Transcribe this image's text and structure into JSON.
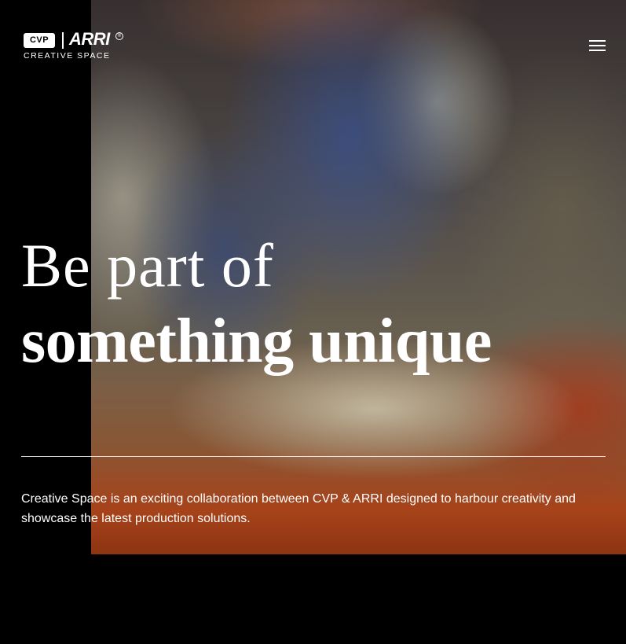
{
  "header": {
    "logo": {
      "cvp": "CVP",
      "arri": "ARRI",
      "registered": "®",
      "subtitle": "CREATIVE SPACE"
    },
    "menu_icon": "hamburger-menu-icon"
  },
  "hero": {
    "headline_line1": "Be part of",
    "headline_line2": "something unique",
    "intro": "Creative Space is an exciting collaboration between CVP & ARRI designed to harbour creativity and showcase the latest production solutions."
  },
  "colors": {
    "background": "#000000",
    "text": "#ffffff",
    "accent_orange": "#b4481c"
  }
}
